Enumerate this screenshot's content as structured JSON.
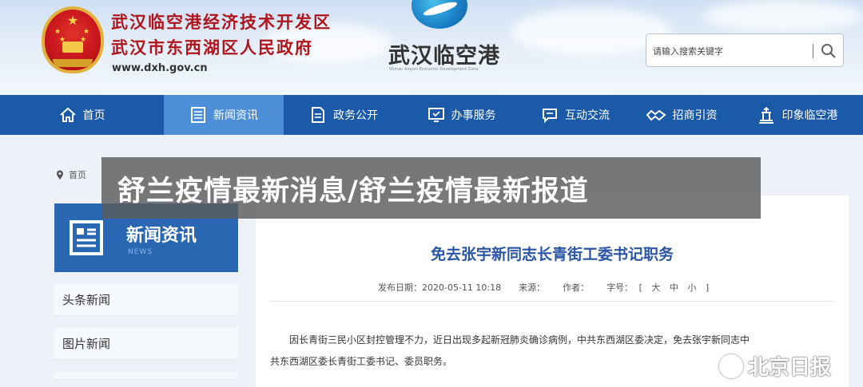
{
  "header": {
    "title_line1": "武汉临空港经济技术开发区",
    "title_line2": "武汉市东西湖区人民政府",
    "url": "www.dxh.gov.cn",
    "logo_text": "武汉临空港",
    "logo_subtext": "Wuhan Airport Economic Development Zone",
    "emblem_icon": "national-emblem-icon"
  },
  "search": {
    "placeholder": "请输入搜索关键字",
    "button_icon": "search-icon"
  },
  "nav": {
    "items": [
      {
        "label": "首页",
        "icon": "home-icon"
      },
      {
        "label": "新闻资讯",
        "icon": "news-icon"
      },
      {
        "label": "政务公开",
        "icon": "document-icon"
      },
      {
        "label": "办事服务",
        "icon": "monitor-check-icon"
      },
      {
        "label": "互动交流",
        "icon": "chat-icon"
      },
      {
        "label": "招商引资",
        "icon": "handshake-icon"
      },
      {
        "label": "印象临空港",
        "icon": "landmark-icon"
      }
    ],
    "active_index": 1,
    "bar_color": "#1b5aa8",
    "active_color": "#4c8fd8"
  },
  "breadcrumb": {
    "icon": "location-pin-icon",
    "text": "首页"
  },
  "sidebar": {
    "heading": "新闻资讯",
    "heading_sub": "NEWS",
    "heading_icon": "newspaper-icon",
    "links": [
      "头条新闻",
      "图片新闻"
    ]
  },
  "article": {
    "title": "免去张宇新同志长青街工委书记职务",
    "date_label": "发布日期：",
    "date": "2020-05-11 10:18",
    "source_label": "来源：",
    "author_label": "作者：",
    "font_size_label": "字号：",
    "font_sizes": {
      "open": "[",
      "large": "大",
      "medium": "中",
      "small": "小",
      "close": "]"
    },
    "body_line1": "因长青街三民小区封控管理不力，近日出现多起新冠肺炎确诊病例，中共东西湖区委决定，免去张宇新同志中",
    "body_line2": "共东西湖区委长青街工委书记、委员职务。"
  },
  "banner": {
    "text": "舒兰疫情最新消息/舒兰疫情最新报道"
  },
  "watermark": {
    "text": "北京日报"
  }
}
